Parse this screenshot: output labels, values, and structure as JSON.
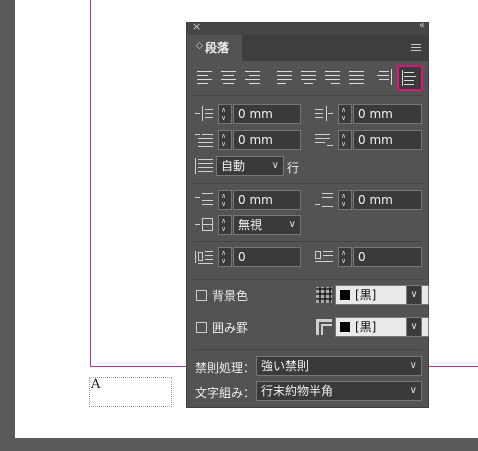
{
  "document": {
    "frame_text": "A"
  },
  "panel": {
    "tab_label": "段落",
    "tab_arrows": "◇",
    "close_glyph": "×",
    "collapse_glyph": "‹‹",
    "indent": {
      "left": "0 mm",
      "right": "0 mm",
      "first_line": "0 mm",
      "last_line": "0 mm"
    },
    "drop_cap": {
      "mode": "自動",
      "unit_label": "行"
    },
    "space": {
      "before": "0 mm",
      "after": "0 mm",
      "align_to_grid": "無視"
    },
    "drop_cap_lines": "0",
    "drop_cap_chars": "0",
    "shading_label": "背景色",
    "shading_color": "[黒]",
    "border_label": "囲み罫",
    "border_color": "[黒]",
    "kinsoku_label": "禁則処理：",
    "kinsoku_value": "強い禁則",
    "mojikumi_label": "文字組み：",
    "mojikumi_value": "行末約物半角",
    "selected_alignment": "justify-all"
  }
}
